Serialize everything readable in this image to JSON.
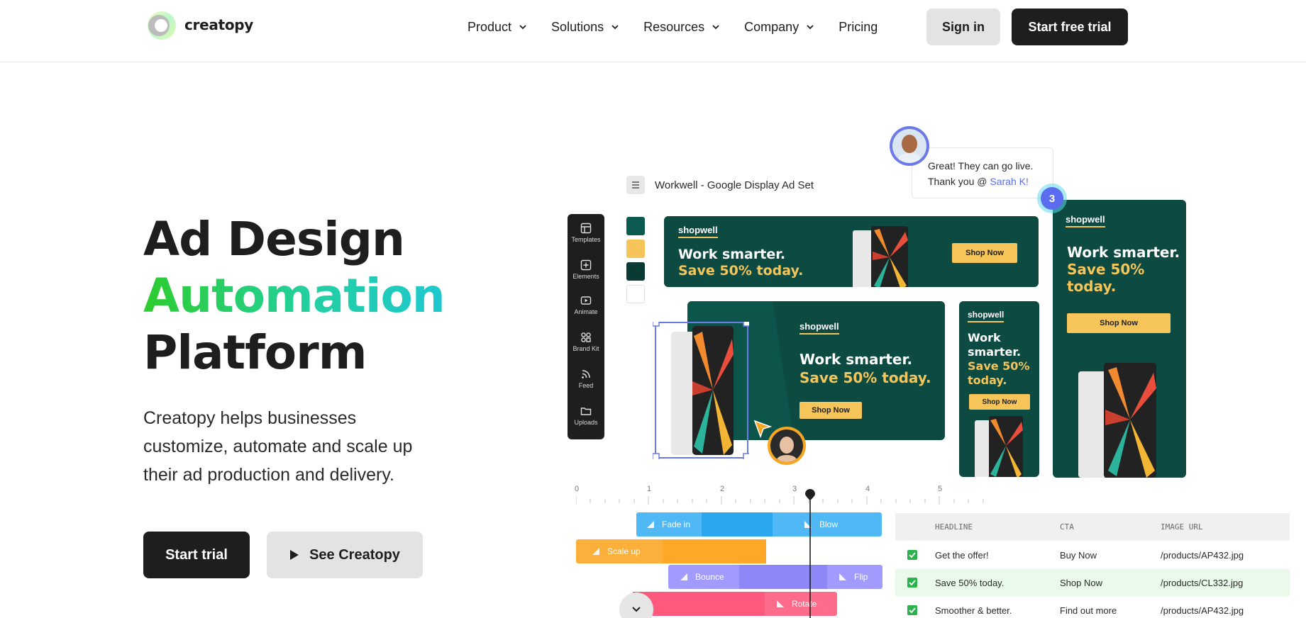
{
  "nav": {
    "brand": "creatopy",
    "menu": [
      {
        "label": "Product",
        "has_dropdown": true
      },
      {
        "label": "Solutions",
        "has_dropdown": true
      },
      {
        "label": "Resources",
        "has_dropdown": true
      },
      {
        "label": "Company",
        "has_dropdown": true
      },
      {
        "label": "Pricing",
        "has_dropdown": false
      }
    ],
    "sign_in": "Sign in",
    "start_free_trial": "Start free trial"
  },
  "hero": {
    "title_line1": "Ad Design",
    "title_line2": "Automation",
    "title_line3": "Platform",
    "subtitle": "Creatopy helps businesses customize, automate and scale up their ad production and delivery.",
    "cta_primary": "Start trial",
    "cta_secondary": "See Creatopy"
  },
  "editor": {
    "document_title": "Workwell - Google Display Ad Set",
    "tools": [
      "Templates",
      "Elements",
      "Animate",
      "Brand Kit",
      "Feed",
      "Uploads"
    ],
    "swatches": [
      "#0c5a50",
      "#f6c55a",
      "#0a3a34",
      "#ffffff"
    ],
    "comment": {
      "line1": "Great! They can go live.",
      "line2_prefix": "Thank you @ ",
      "mention": "Sarah K!"
    },
    "comment_count": "3",
    "ads": {
      "brand": "shopwell",
      "headline": "Work smarter.",
      "offer": "Save 50% today.",
      "cta": "Shop Now",
      "tall_headline": "Work smarter.",
      "tall_offer": "Save 50% today.",
      "narrow_headline_1": "Work",
      "narrow_headline_2": "smarter.",
      "narrow_offer_1": "Save 50%",
      "narrow_offer_2": "today."
    }
  },
  "timeline": {
    "ruler": [
      "0",
      "1",
      "2",
      "3",
      "4",
      "5"
    ],
    "tracks": [
      {
        "label": "Fade in",
        "color": "#4fb8f5"
      },
      {
        "label": "Blow",
        "color": "#4fb8f5"
      },
      {
        "label": "Scale up",
        "color": "#fbb03b"
      },
      {
        "label": "Bounce",
        "color": "#a29bfe"
      },
      {
        "label": "Flip",
        "color": "#a29bfe"
      },
      {
        "label": "Rotate",
        "color": "#ff6b8a"
      }
    ]
  },
  "feed_table": {
    "columns": [
      "HEADLINE",
      "CTA",
      "IMAGE URL"
    ],
    "rows": [
      {
        "headline": "Get the offer!",
        "cta": "Buy Now",
        "image_url": "/products/AP432.jpg"
      },
      {
        "headline": "Save 50% today.",
        "cta": "Shop Now",
        "image_url": "/products/CL332.jpg"
      },
      {
        "headline": "Smoother & better.",
        "cta": "Find out more",
        "image_url": "/products/AP432.jpg"
      }
    ]
  },
  "colors": {
    "dark": "#1e1e1e",
    "ad_green": "#0c4a42",
    "ad_yellow": "#f6c55a",
    "accent_purple": "#5b6cf0"
  }
}
